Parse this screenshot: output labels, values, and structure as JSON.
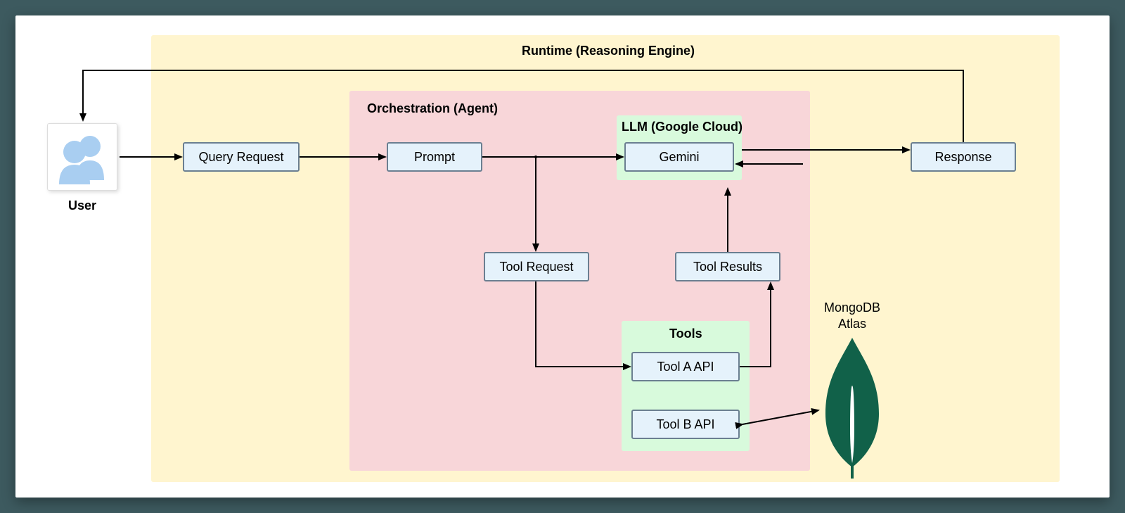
{
  "regions": {
    "runtime": "Runtime (Reasoning Engine)",
    "orchestration": "Orchestration (Agent)",
    "llm": "LLM (Google Cloud)",
    "tools": "Tools"
  },
  "nodes": {
    "user_label": "User",
    "query_request": "Query Request",
    "prompt": "Prompt",
    "gemini": "Gemini",
    "tool_request": "Tool Request",
    "tool_results": "Tool Results",
    "tool_a_api": "Tool A API",
    "tool_b_api": "Tool B API",
    "response": "Response"
  },
  "external": {
    "mongodb_line1": "MongoDB",
    "mongodb_line2": "Atlas"
  },
  "colors": {
    "page_bg": "#3d5a5f",
    "canvas_bg": "#ffffff",
    "runtime_bg": "#fff5cf",
    "orchestration_bg": "#f8d6d9",
    "green_bg": "#d8fadc",
    "node_fill": "#e5f2fb",
    "node_border": "#6b7f91",
    "arrow": "#000000",
    "mongo_leaf": "#116149",
    "user_icon": "#a9cef1"
  },
  "icons": {
    "user": "people-icon",
    "mongodb": "mongodb-leaf-icon"
  }
}
